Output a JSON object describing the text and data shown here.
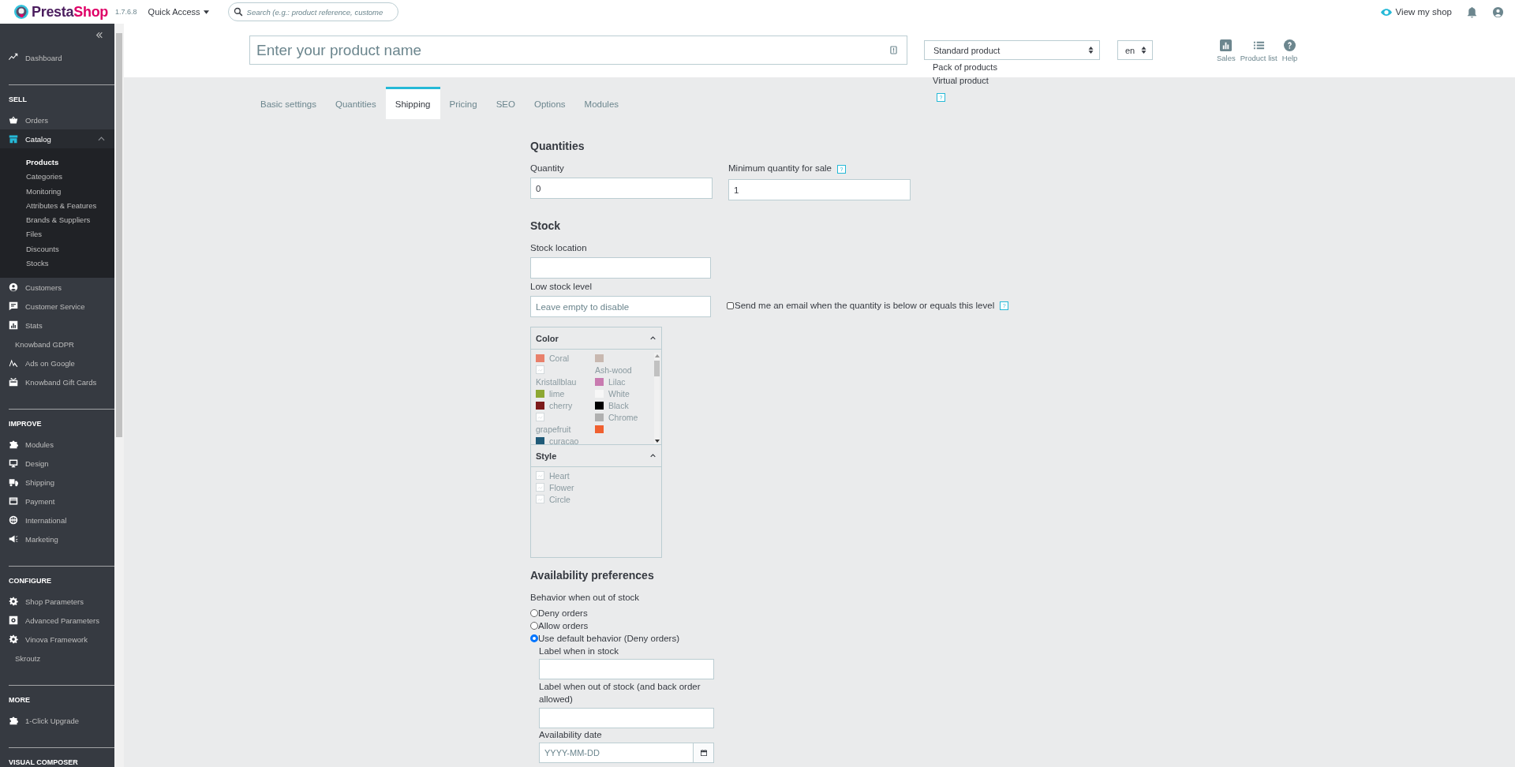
{
  "header": {
    "logo_prefix": "Presta",
    "logo_suffix": "Shop",
    "version": "1.7.6.8",
    "quick_access": "Quick Access",
    "search": {
      "placeholder": "Search (e.g.: product reference, custome"
    },
    "view_shop": "View my shop"
  },
  "sidebar": {
    "sections": [
      {
        "items": [
          {
            "label": "Dashboard",
            "selected": false
          }
        ]
      },
      {
        "title": "SELL",
        "items": [
          {
            "label": "Orders",
            "selected": false
          },
          {
            "label": "Catalog",
            "selected": true,
            "expanded": true,
            "children": [
              {
                "label": "Products",
                "selected": true
              },
              {
                "label": "Categories",
                "selected": false
              },
              {
                "label": "Monitoring",
                "selected": false
              },
              {
                "label": "Attributes & Features",
                "selected": false
              },
              {
                "label": "Brands & Suppliers",
                "selected": false
              },
              {
                "label": "Files",
                "selected": false
              },
              {
                "label": "Discounts",
                "selected": false
              },
              {
                "label": "Stocks",
                "selected": false
              }
            ]
          },
          {
            "label": "Customers",
            "selected": false
          },
          {
            "label": "Customer Service",
            "selected": false
          },
          {
            "label": "Stats",
            "selected": false
          },
          {
            "label": "Knowband GDPR",
            "selected": false
          },
          {
            "label": "Ads on Google",
            "selected": false
          },
          {
            "label": "Knowband Gift Cards",
            "selected": false
          }
        ]
      },
      {
        "title": "IMPROVE",
        "items": [
          {
            "label": "Modules",
            "selected": false
          },
          {
            "label": "Design",
            "selected": false
          },
          {
            "label": "Shipping",
            "selected": false
          },
          {
            "label": "Payment",
            "selected": false
          },
          {
            "label": "International",
            "selected": false
          },
          {
            "label": "Marketing",
            "selected": false
          }
        ]
      },
      {
        "title": "CONFIGURE",
        "items": [
          {
            "label": "Shop Parameters",
            "selected": false
          },
          {
            "label": "Advanced Parameters",
            "selected": false
          },
          {
            "label": "Vinova Framework",
            "selected": false
          },
          {
            "label": "Skroutz",
            "selected": false
          }
        ]
      },
      {
        "title": "MORE",
        "items": [
          {
            "label": "1-Click Upgrade",
            "selected": false
          }
        ]
      },
      {
        "title": "VISUAL COMPOSER"
      }
    ]
  },
  "product_bar": {
    "name": {
      "placeholder": "Enter your product name"
    },
    "type": {
      "value": "Standard product",
      "options": [
        "Pack of products",
        "Virtual product"
      ],
      "help": "?"
    },
    "language": {
      "value": "en"
    },
    "actions": [
      {
        "label": "Sales"
      },
      {
        "label": "Product list"
      },
      {
        "label": "Help"
      }
    ]
  },
  "tabs": [
    {
      "label": "Basic settings",
      "selected": false
    },
    {
      "label": "Quantities",
      "selected": false
    },
    {
      "label": "Shipping",
      "selected": true
    },
    {
      "label": "Pricing",
      "selected": false
    },
    {
      "label": "SEO",
      "selected": false
    },
    {
      "label": "Options",
      "selected": false
    },
    {
      "label": "Modules",
      "selected": false
    }
  ],
  "quantities": {
    "title": "Quantities",
    "quantity": {
      "label": "Quantity",
      "value": "0"
    },
    "minimum": {
      "label": "Minimum quantity for sale",
      "help": "?",
      "value": "1"
    }
  },
  "stock": {
    "title": "Stock",
    "location": {
      "label": "Stock location"
    },
    "low_level": {
      "label": "Low stock level",
      "placeholder": "Leave empty to disable"
    },
    "email_alert": {
      "label": "Send me an email when the quantity is below or equals this level",
      "checked": false,
      "help": "?"
    },
    "filters": [
      {
        "title": "Color",
        "columns": [
          [
            {
              "label": "Coral",
              "kind": "swatch",
              "color": "#e8806b"
            },
            {
              "label": "Kristallblau",
              "kind": "image"
            },
            {
              "label": "lime",
              "kind": "swatch",
              "color": "#8da832"
            },
            {
              "label": "cherry",
              "kind": "swatch",
              "color": "#7d1a1a"
            },
            {
              "label": "grapefruit",
              "kind": "image"
            },
            {
              "label": "curacao",
              "kind": "swatch",
              "color": "#1f5a78"
            }
          ],
          [
            {
              "label": "Ash-wood",
              "kind": "swatch",
              "color": "#c8b8b0"
            },
            {
              "label": "Lilac",
              "kind": "swatch",
              "color": "#c87ab0"
            },
            {
              "label": "White",
              "kind": "swatch",
              "color": "#f7f7f7"
            },
            {
              "label": "Black",
              "kind": "swatch",
              "color": "#000000"
            },
            {
              "label": "Chrome",
              "kind": "swatch",
              "color": "#b0b0b0"
            },
            {
              "kind": "swatch",
              "color": "#f06030"
            }
          ]
        ]
      },
      {
        "title": "Style",
        "columns": [
          [
            {
              "label": "Heart",
              "kind": "image"
            },
            {
              "label": "Flower",
              "kind": "image"
            },
            {
              "label": "Circle",
              "kind": "image"
            }
          ]
        ]
      }
    ]
  },
  "availability": {
    "title": "Availability preferences",
    "behavior_label": "Behavior when out of stock",
    "options": [
      {
        "label": "Deny orders",
        "selected": false
      },
      {
        "label": "Allow orders",
        "selected": false
      },
      {
        "label": "Use default behavior (Deny orders)",
        "selected": true
      }
    ],
    "in_stock_label": "Label when in stock",
    "out_of_stock_label": "Label when out of stock (and back order allowed)",
    "date": {
      "label": "Availability date",
      "placeholder": "YYYY-MM-DD"
    }
  }
}
